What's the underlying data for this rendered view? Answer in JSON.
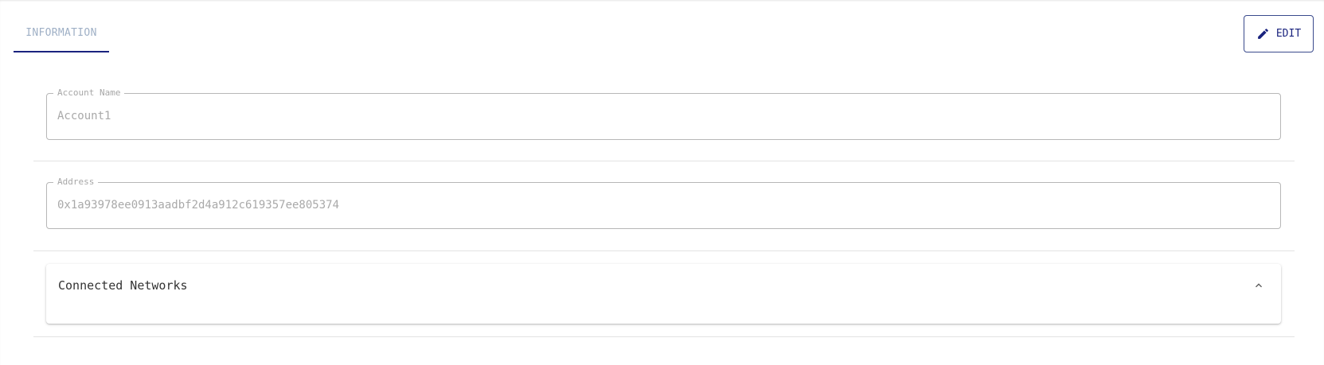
{
  "tabs": [
    {
      "label": "INFORMATION",
      "active": true
    }
  ],
  "toolbar": {
    "edit_label": "EDIT",
    "edit_icon": "pencil-icon"
  },
  "fields": {
    "account_name": {
      "label": "Account Name",
      "value": "Account1"
    },
    "address": {
      "label": "Address",
      "value": "0x1a93978ee0913aadbf2d4a912c619357ee805374"
    }
  },
  "connected_networks": {
    "title": "Connected Networks",
    "expanded": true,
    "icon": "chevron-up-icon"
  },
  "colors": {
    "accent": "#1a237e",
    "tab_text": "#9fb0c6",
    "field_border": "#b7b7b7",
    "muted_text": "#a9a9a9"
  }
}
